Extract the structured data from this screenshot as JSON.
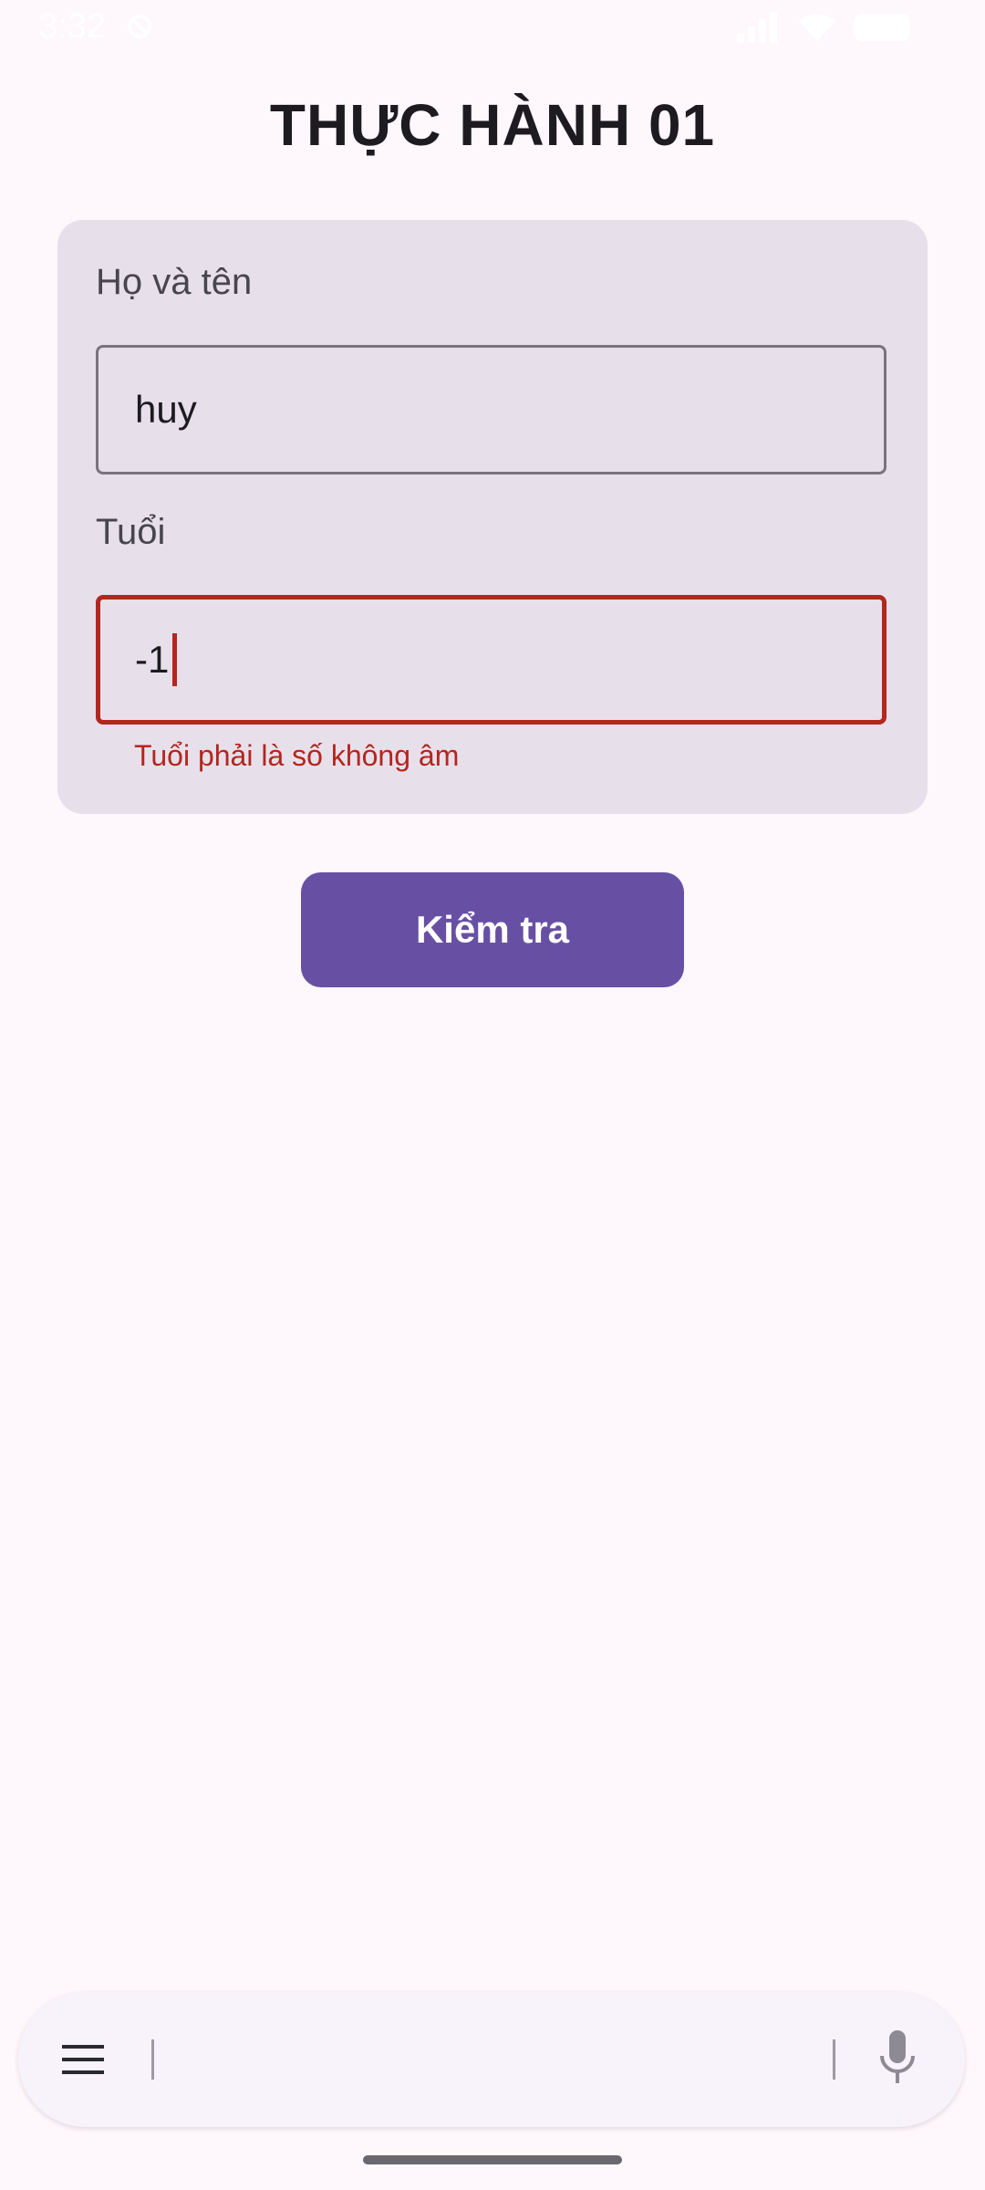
{
  "status_bar": {
    "time": "3:32"
  },
  "title": "THỰC HÀNH 01",
  "form": {
    "name_label": "Họ và tên",
    "name_value": "huy",
    "age_label": "Tuổi",
    "age_value": "-1",
    "age_error": "Tuổi phải là số không âm"
  },
  "check_button_label": "Kiểm tra",
  "colors": {
    "primary": "#6750A4",
    "error": "#B3261E",
    "card": "#E7E0EB",
    "background": "#FEF7FC"
  },
  "icons": {
    "menu": "menu-icon",
    "mic": "mic-icon",
    "dnd": "do-not-disturb-icon",
    "signal": "signal-icon",
    "wifi": "wifi-icon",
    "battery": "battery-icon"
  }
}
